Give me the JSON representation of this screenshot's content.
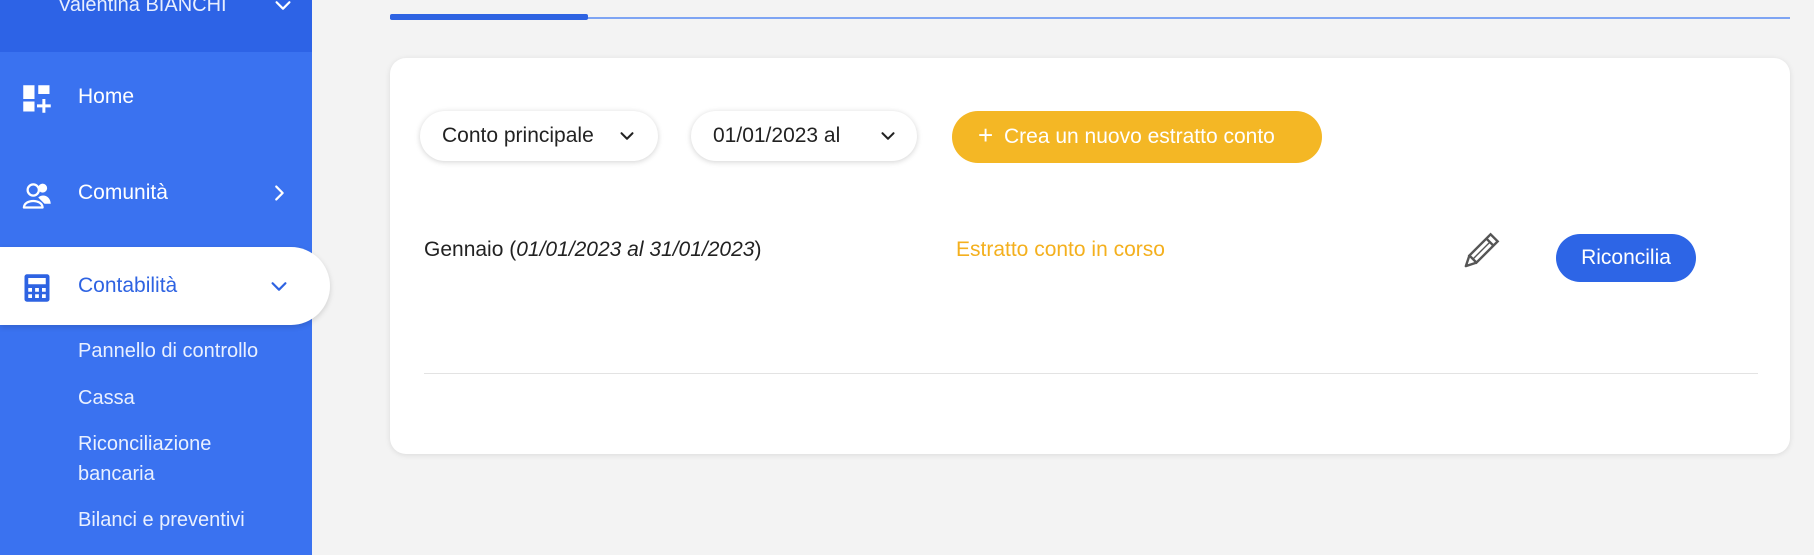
{
  "user": {
    "name": "Valentina BIANCHI"
  },
  "sidebar": {
    "items": [
      {
        "label": "Home",
        "icon": "dashboard-icon"
      },
      {
        "label": "Comunità",
        "icon": "users-icon"
      },
      {
        "label": "Contabilità",
        "icon": "calculator-icon"
      }
    ],
    "subitems": [
      {
        "label": "Pannello di controllo"
      },
      {
        "label": "Cassa"
      },
      {
        "label": "Riconciliazione bancaria"
      },
      {
        "label": "Bilanci e preventivi"
      }
    ]
  },
  "filters": {
    "account": "Conto principale",
    "date": "01/01/2023 al"
  },
  "create_button": {
    "label": "Crea un nuovo estratto conto"
  },
  "statement": {
    "month": "Gennaio",
    "period": "01/01/2023 al 31/01/2023",
    "status": "Estratto conto in corso",
    "action": "Riconcilia"
  },
  "colors": {
    "sidebar": "#3a72f0",
    "primary": "#2d65e6",
    "accent": "#f4b725",
    "status": "#f4b01e",
    "background": "#f3f3f3"
  }
}
